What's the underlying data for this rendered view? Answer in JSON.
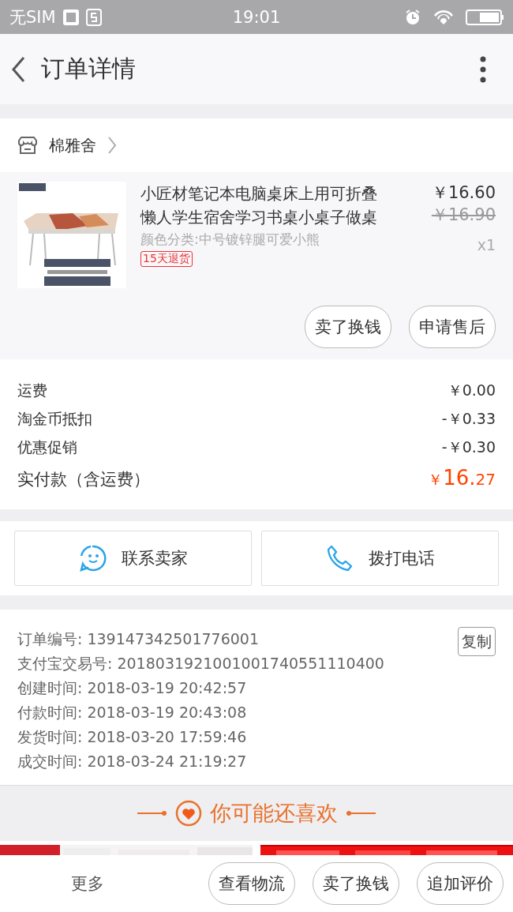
{
  "status_bar": {
    "carrier": "无SIM",
    "time": "19:01"
  },
  "header": {
    "title": "订单详情"
  },
  "shop": {
    "name": "棉雅舍"
  },
  "item": {
    "title": "小匠材笔记本电脑桌床上用可折叠懒人学生宿舍学习书桌小桌子做桌",
    "variant": "颜色分类:中号镀锌腿可爱小熊",
    "tag": "15天退货",
    "price": "￥16.60",
    "original_price": "￥16.90",
    "quantity": "x1",
    "buttons": [
      "卖了换钱",
      "申请售后"
    ]
  },
  "fees": [
    {
      "label": "运费",
      "value": "￥0.00"
    },
    {
      "label": "淘金币抵扣",
      "value": "-￥0.33"
    },
    {
      "label": "优惠促销",
      "value": "-￥0.30"
    }
  ],
  "total": {
    "label": "实付款（含运费）",
    "currency": "￥",
    "integer": "16.",
    "decimals": "27"
  },
  "contact": [
    {
      "kind": "chat",
      "label": "联系卖家"
    },
    {
      "kind": "phone",
      "label": "拨打电话"
    }
  ],
  "order_info": {
    "copy_button": "复制",
    "lines": [
      "订单编号: 139147342501776001",
      "支付宝交易号: 2018031921001001740551110400",
      "创建时间: 2018-03-19 20:42:57",
      "付款时间: 2018-03-19 20:43:08",
      "发货时间: 2018-03-20 17:59:46",
      "成交时间: 2018-03-24 21:19:27"
    ]
  },
  "recommend": {
    "title": "你可能还喜欢"
  },
  "bottom_bar": {
    "more": "更多",
    "buttons": [
      "查看物流",
      "卖了换钱",
      "追加评价"
    ]
  }
}
